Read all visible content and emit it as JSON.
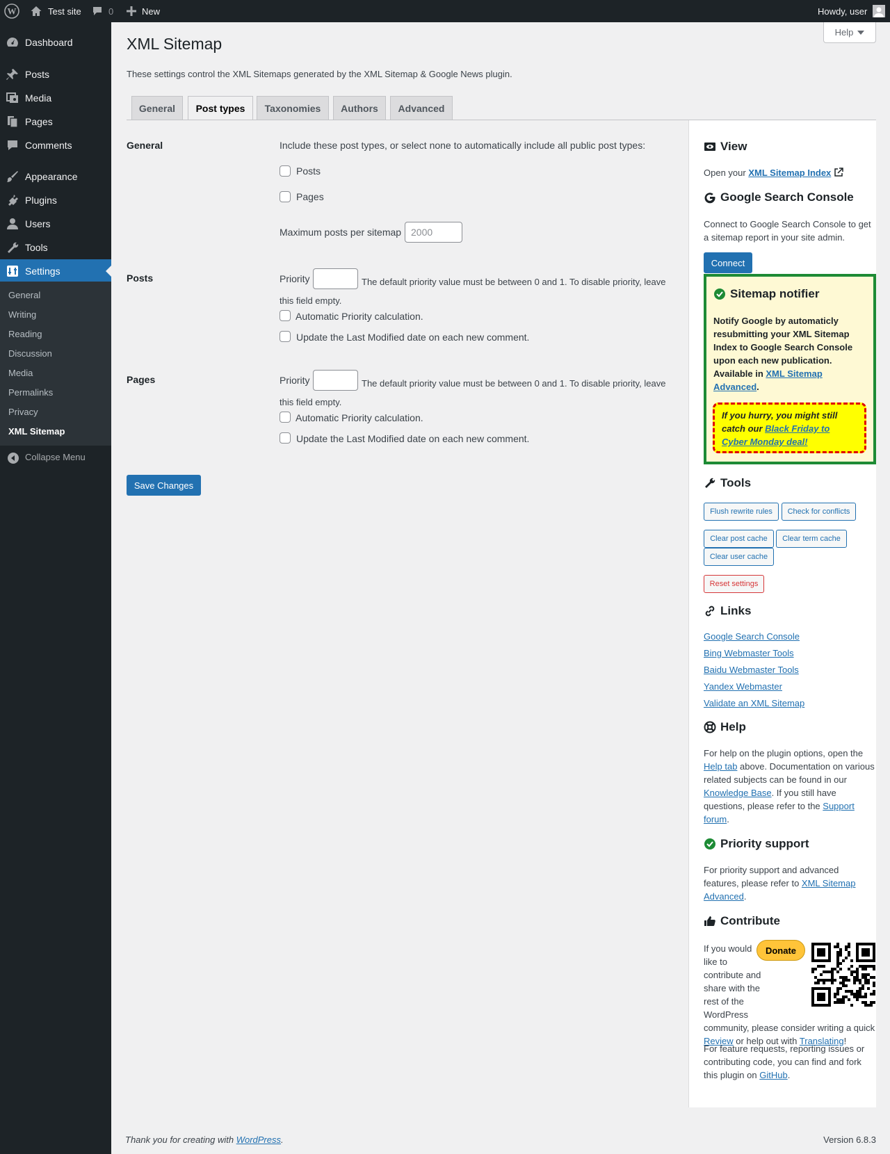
{
  "adminbar": {
    "site_name": "Test site",
    "comments_count": "0",
    "new_label": "New",
    "howdy": "Howdy, user"
  },
  "menu": {
    "items": [
      {
        "label": "Dashboard",
        "icon": "dashboard-icon"
      },
      {
        "label": "Posts",
        "icon": "pin-icon"
      },
      {
        "label": "Media",
        "icon": "media-icon"
      },
      {
        "label": "Pages",
        "icon": "pages-icon"
      },
      {
        "label": "Comments",
        "icon": "comments-icon"
      },
      {
        "label": "Appearance",
        "icon": "paintbrush-icon"
      },
      {
        "label": "Plugins",
        "icon": "plugin-icon"
      },
      {
        "label": "Users",
        "icon": "users-icon"
      },
      {
        "label": "Tools",
        "icon": "wrench-icon"
      },
      {
        "label": "Settings",
        "icon": "settings-icon"
      }
    ],
    "submenu": [
      "General",
      "Writing",
      "Reading",
      "Discussion",
      "Media",
      "Permalinks",
      "Privacy",
      "XML Sitemap"
    ],
    "collapse": "Collapse Menu"
  },
  "page": {
    "title": "XML Sitemap",
    "help": "Help",
    "intro": "These settings control the XML Sitemaps generated by the XML Sitemap & Google News plugin.",
    "tabs": [
      "General",
      "Post types",
      "Taxonomies",
      "Authors",
      "Advanced"
    ],
    "active_tab": "Post types"
  },
  "form": {
    "general": {
      "heading": "General",
      "include_text": "Include these post types, or select none to automatically include all public post types:",
      "options": [
        "Posts",
        "Pages"
      ],
      "max_label": "Maximum posts per sitemap",
      "max_placeholder": "2000"
    },
    "posts": {
      "heading": "Posts",
      "priority_label": "Priority",
      "priority_desc_1": "The default priority value must be between 0 and 1. To disable priority, leave",
      "priority_desc_2": "this field empty.",
      "auto": "Automatic Priority calculation.",
      "update": "Update the Last Modified date on each new comment."
    },
    "pages": {
      "heading": "Pages",
      "priority_label": "Priority",
      "priority_desc_1": "The default priority value must be between 0 and 1. To disable priority, leave",
      "priority_desc_2": "this field empty.",
      "auto": "Automatic Priority calculation.",
      "update": "Update the Last Modified date on each new comment."
    },
    "save": "Save Changes"
  },
  "sidebar": {
    "view": {
      "heading": "View",
      "text": "Open your ",
      "link": "XML Sitemap Index"
    },
    "gsc": {
      "heading": "Google Search Console",
      "text": "Connect to Google Search Console to get a sitemap report in your site admin.",
      "button": "Connect"
    },
    "notifier": {
      "heading": "Sitemap notifier",
      "text": "Notify Google by automaticly resubmitting your XML Sitemap Index to Google Search Console upon each new publication. Available in ",
      "link": "XML Sitemap Advanced",
      "hurry_text": "If you hurry, you might still catch our ",
      "hurry_link": "Black Friday to Cyber Monday deal!"
    },
    "tools": {
      "heading": "Tools",
      "flush": "Flush rewrite rules",
      "conflicts": "Check for conflicts",
      "post_cache": "Clear post cache",
      "term_cache": "Clear term cache",
      "user_cache": "Clear user cache",
      "reset": "Reset settings"
    },
    "links": {
      "heading": "Links",
      "items": [
        "Google Search Console",
        "Bing Webmaster Tools",
        "Baidu Webmaster Tools",
        "Yandex Webmaster",
        "Validate an XML Sitemap"
      ]
    },
    "help": {
      "heading": "Help",
      "t1": "For help on the plugin options, open the ",
      "l1": "Help tab",
      "t2": " above. Documentation on various related subjects can be found in our ",
      "l2": "Knowledge Base",
      "t3": ". If you still have questions, please refer to the ",
      "l3": "Support forum",
      "t4": "."
    },
    "priority": {
      "heading": "Priority support",
      "text": "For priority support and advanced features, please refer to ",
      "link": "XML Sitemap Advanced",
      "end": "."
    },
    "contribute": {
      "heading": "Contribute",
      "donate": "Donate",
      "t1": "If you would like to contribute and share with the rest of the WordPress community, please consider writing a quick ",
      "l1": "Review",
      "t2": " or help out with ",
      "l2": "Translating",
      "t3": "!",
      "f1": "For feature requests, reporting issues or contributing code, you can find and fork this plugin on ",
      "fl": "GitHub",
      "f2": "."
    }
  },
  "footer": {
    "thanks": "Thank you for creating with ",
    "wp_link": "WordPress",
    "thanks_end": ".",
    "version": "Version 6.8.3"
  },
  "colors": {
    "accent": "#2271b1",
    "menu_bg": "#1d2327",
    "notifier_border": "#1d8b35",
    "danger": "#d63638"
  }
}
